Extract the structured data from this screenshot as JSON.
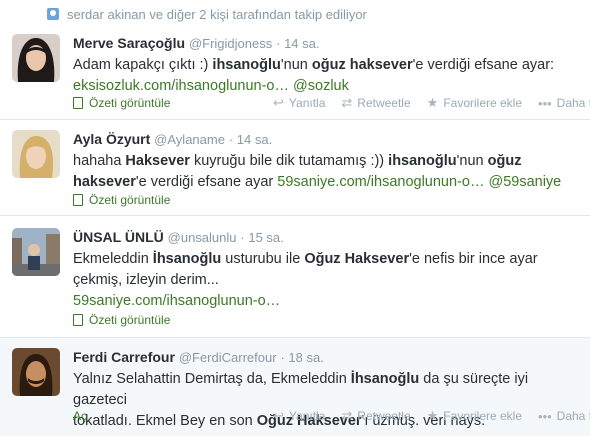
{
  "context": {
    "text": "serdar akinan ve diğer 2 kişi tarafından takip ediliyor"
  },
  "actions": {
    "reply": "Yanıtla",
    "retweet": "Retweetle",
    "favorite": "Favorilere ekle",
    "more": "Daha fazla",
    "summary": "Özeti görüntüle",
    "open": "Aç"
  },
  "tweets": [
    {
      "name": "Merve Saraçoğlu",
      "handle": "@Frigidjoness",
      "time": "14 sa.",
      "t1": "Adam kapakçı çıktı :) ",
      "t2": "ihsanoğlu",
      "t3": "'nun ",
      "t4": "oğuz haksever",
      "t5": "'e verdiği efsane ayar:",
      "link": "eksisozluk.com/ihsanoglunun-o…",
      "mention": "@sozluk"
    },
    {
      "name": "Ayla Özyurt",
      "handle": "@Aylaname",
      "time": "14 sa.",
      "t1": "hahaha ",
      "t2": "Haksever",
      "t3": " kuyruğu bile dik tutamamış :)) ",
      "t4": "ihsanoğlu",
      "t5": "'nun ",
      "t6": "oğuz",
      "t7": "haksever",
      "t8": "'e verdiği efsane ayar ",
      "link": "59saniye.com/ihsanoglunun-o…",
      "mention": "@59saniye"
    },
    {
      "name": "ÜNSAL ÜNLÜ",
      "handle": "@unsalunlu",
      "time": "15 sa.",
      "t1": "Ekmeleddin ",
      "t2": "İhsanoğlu",
      "t3": " usturubu ile ",
      "t4": "Oğuz Haksever",
      "t5": "'e nefis bir ince ayar",
      "t6": "çekmiş, izleyin derim...",
      "link": "59saniye.com/ihsanoglunun-o…"
    },
    {
      "name": "Ferdi Carrefour",
      "handle": "@FerdiCarrefour",
      "time": "18 sa.",
      "t1": "Yalnız Selahattin Demirtaş da, Ekmeleddin ",
      "t2": "İhsanoğlu",
      "t3": " da şu süreçte iyi gazeteci",
      "t4": "tokatladı. Ekmel Bey en son ",
      "t5": "Oğuz Haksever",
      "t6": "'ı üzmüş. veri nays."
    }
  ]
}
